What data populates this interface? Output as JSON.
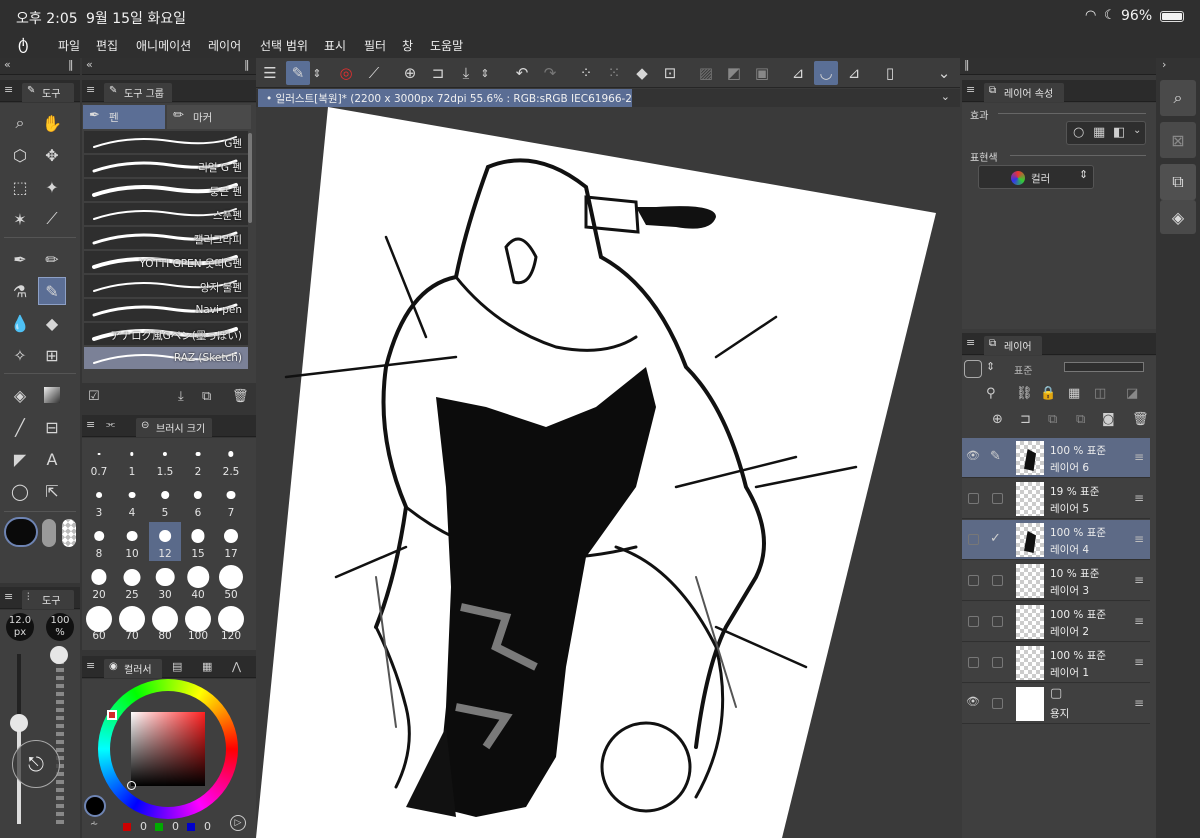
{
  "status": {
    "time": "오후 2:05",
    "date": "9월 15일 화요일",
    "battery": "96%"
  },
  "menu": [
    "파일",
    "편집",
    "애니메이션",
    "레이어",
    "선택 범위",
    "표시",
    "필터",
    "창",
    "도움말"
  ],
  "document": {
    "title": "일러스트[복원]* (2200 x 3000px 72dpi 55.6% : RGB:sRGB IEC61966-2.1)"
  },
  "tool_panel": {
    "tab_label": "도구"
  },
  "subtool_panel": {
    "group_tab": "도구 그룹",
    "tab_pen": "펜",
    "tab_marker": "마커",
    "items": [
      "G펜",
      "리얼 G 펜",
      "둥근 펜",
      "스푼펜",
      "캘리그라피",
      "YOTTI GPEN 옷띠G펜",
      "앙지 물펜",
      "Navi pen",
      "アナログ風Gペン(墨っぽい)",
      "RAZ (Sketch)"
    ],
    "selected_index": 9
  },
  "brush_size_panel": {
    "tab_label": "브러시 크기",
    "sizes": [
      "0.7",
      "1",
      "1.5",
      "2",
      "2.5",
      "3",
      "4",
      "5",
      "6",
      "7",
      "8",
      "10",
      "12",
      "15",
      "17",
      "20",
      "25",
      "30",
      "40",
      "50",
      "60",
      "70",
      "80",
      "100",
      "120"
    ],
    "selected": "12"
  },
  "tool_property": {
    "tab_label": "도구",
    "size_value": "12.0",
    "size_unit": "px",
    "opacity_value": "100",
    "opacity_unit": "%"
  },
  "color_panel": {
    "tab_label": "컬러서",
    "r_value": "0",
    "g_value": "0",
    "b_value": "0",
    "main_color": "#000000",
    "hue_marker_color": "#d42a2a"
  },
  "layer_property": {
    "tab_label": "레이어 속성",
    "effect_label": "효과",
    "expression_label": "표현색",
    "expression_value": "컬러"
  },
  "layer_panel": {
    "tab_label": "레이어",
    "blend_mode": "표준",
    "layers": [
      {
        "opacity": "100 %",
        "mode": "표준",
        "name": "레이어 6",
        "visible": true,
        "selected": true,
        "editing": true
      },
      {
        "opacity": "19 %",
        "mode": "표준",
        "name": "레이어 5",
        "visible": false,
        "selected": false
      },
      {
        "opacity": "100 %",
        "mode": "표준",
        "name": "레이어 4",
        "visible": false,
        "selected": true,
        "checked": true
      },
      {
        "opacity": "10 %",
        "mode": "표준",
        "name": "레이어 3",
        "visible": false,
        "selected": false
      },
      {
        "opacity": "100 %",
        "mode": "표준",
        "name": "레이어 2",
        "visible": false,
        "selected": false
      },
      {
        "opacity": "100 %",
        "mode": "표준",
        "name": "레이어 1",
        "visible": false,
        "selected": false
      },
      {
        "opacity": "",
        "mode": "",
        "name": "용지",
        "visible": true,
        "selected": false
      }
    ]
  },
  "colors": {
    "accent": "#5b6e95",
    "panel_bg": "#3f3f3f",
    "canvas_bg": "#3a3a3a"
  }
}
